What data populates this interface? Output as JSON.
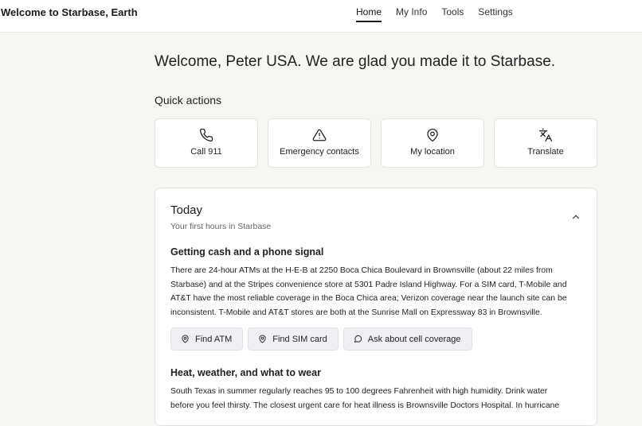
{
  "header": {
    "brand": "Welcome to Starbase, Earth",
    "nav": [
      {
        "label": "Home",
        "active": true
      },
      {
        "label": "My Info"
      },
      {
        "label": "Tools"
      },
      {
        "label": "Settings"
      }
    ]
  },
  "welcome": "Welcome, Peter USA. We are glad you made it to Starbase.",
  "quick_actions": {
    "title": "Quick actions",
    "items": [
      {
        "label": "Call 911",
        "icon": "phone-icon"
      },
      {
        "label": "Emergency contacts",
        "icon": "warning-icon"
      },
      {
        "label": "My location",
        "icon": "map-pin-icon"
      },
      {
        "label": "Translate",
        "icon": "translate-icon"
      }
    ]
  },
  "today": {
    "title": "Today",
    "subtitle": "Your first hours in Starbase",
    "sections": [
      {
        "title": "Getting cash and a phone signal",
        "lines": [
          "There are 24-hour ATMs at the H-E-B at 2250 Boca Chica Boulevard in Brownsville (about 22 miles from",
          "Starbase) and at the Stripes convenience store at 5301 Padre Island Highway. For a SIM card, T-Mobile and",
          "AT&T have the most reliable coverage in the Boca Chica area; Verizon coverage near the launch site can be",
          "inconsistent. T-Mobile and AT&T stores are both at the Sunrise Mall on Expressway 83 in Brownsville."
        ],
        "actions": [
          "Find ATM",
          "Find SIM card",
          "Ask about cell coverage"
        ]
      },
      {
        "title": "Heat, weather, and what to wear",
        "lines": [
          "South Texas in summer regularly reaches 95 to 100 degrees Fahrenheit with high humidity. Drink water",
          "before you feel thirsty. The closest urgent care for heat illness is Brownsville Doctors Hospital. In hurricane"
        ]
      }
    ]
  },
  "colors": {
    "page_bg": "#f6f6f3",
    "card_bg": "#ffffff",
    "chip_bg": "#eef0f3"
  }
}
